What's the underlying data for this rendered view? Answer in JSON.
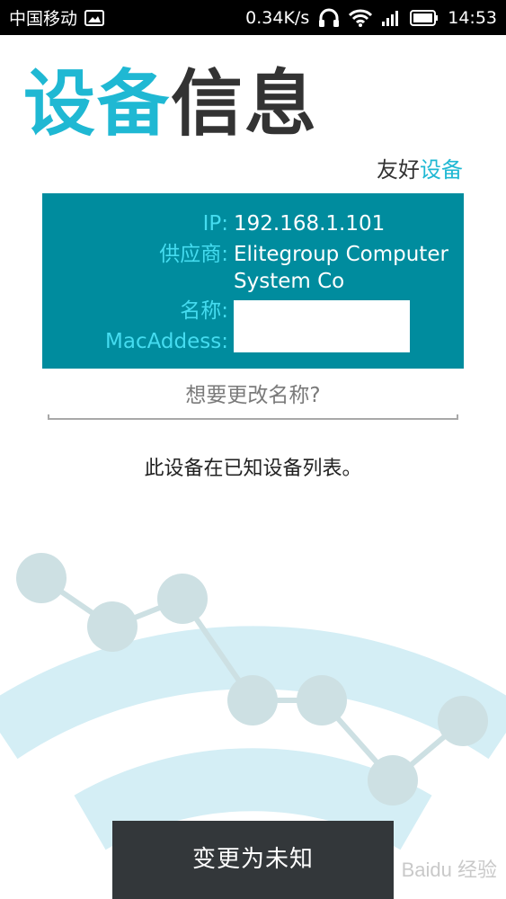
{
  "status_bar": {
    "carrier": "中国移动",
    "speed": "0.34K/s",
    "time": "14:53",
    "icons": [
      "image-icon",
      "headphones-icon",
      "wifi-icon",
      "signal-icon",
      "battery-icon"
    ]
  },
  "title": {
    "part1": "设备",
    "part2": "信息"
  },
  "subtitle": {
    "part1": "友好",
    "part2": "设备"
  },
  "info": {
    "ip_label": "IP:",
    "ip_value": "192.168.1.101",
    "vendor_label": "供应商:",
    "vendor_value": "Elitegroup Computer System Co",
    "name_label": "名称:",
    "mac_label": "MacAddess:"
  },
  "rename_prompt": "想要更改名称?",
  "known_message": "此设备在已知设备列表。",
  "button_label": "变更为未知",
  "watermark": "Baidu 经验",
  "colors": {
    "accent": "#1fb8d3",
    "panel": "#008c9e",
    "label": "#45dcf0",
    "button": "#33373a",
    "illustration_arc": "#d4eef5",
    "illustration_node": "#cde0e3"
  }
}
